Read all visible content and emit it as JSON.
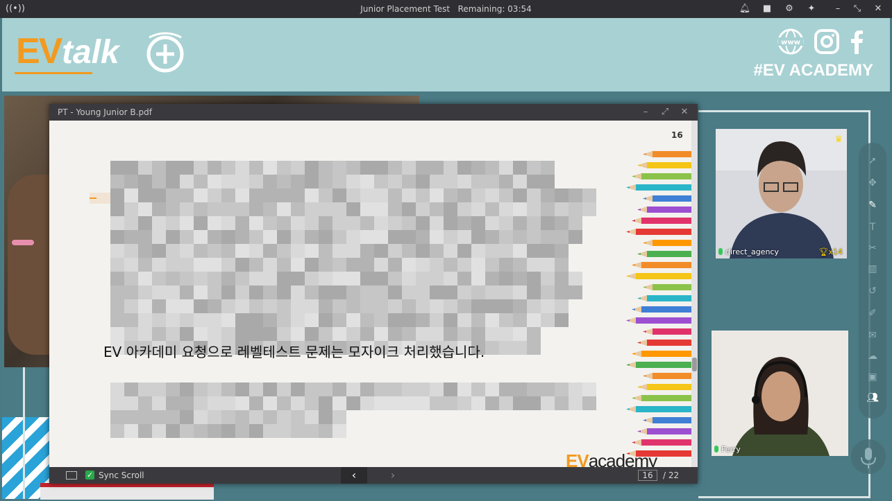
{
  "window": {
    "title": "Junior Placement Test",
    "remaining_label": "Remaining: 03:54"
  },
  "banner": {
    "logo_ev": "EV",
    "logo_talk": "talk",
    "social_www": "www",
    "hashtag": "#EV ACADEMY"
  },
  "pdf": {
    "filename": "PT - Young Junior B.pdf",
    "page_number": "16",
    "notice": "EV 아카데미 요청으로 레벨테스트 문제는 모자이크 처리했습니다.",
    "brand_ev": "EV",
    "brand_rest": "academy",
    "sync_scroll_label": "Sync Scroll",
    "current_page": "16",
    "total_pages": "/ 22"
  },
  "participants": [
    {
      "name": "direct_agency",
      "trophies": "x14"
    },
    {
      "name": "Ferry"
    }
  ],
  "colors": {
    "accent": "#f29a1f",
    "banner": "#a8d1d3",
    "stage": "#4b7b85"
  }
}
